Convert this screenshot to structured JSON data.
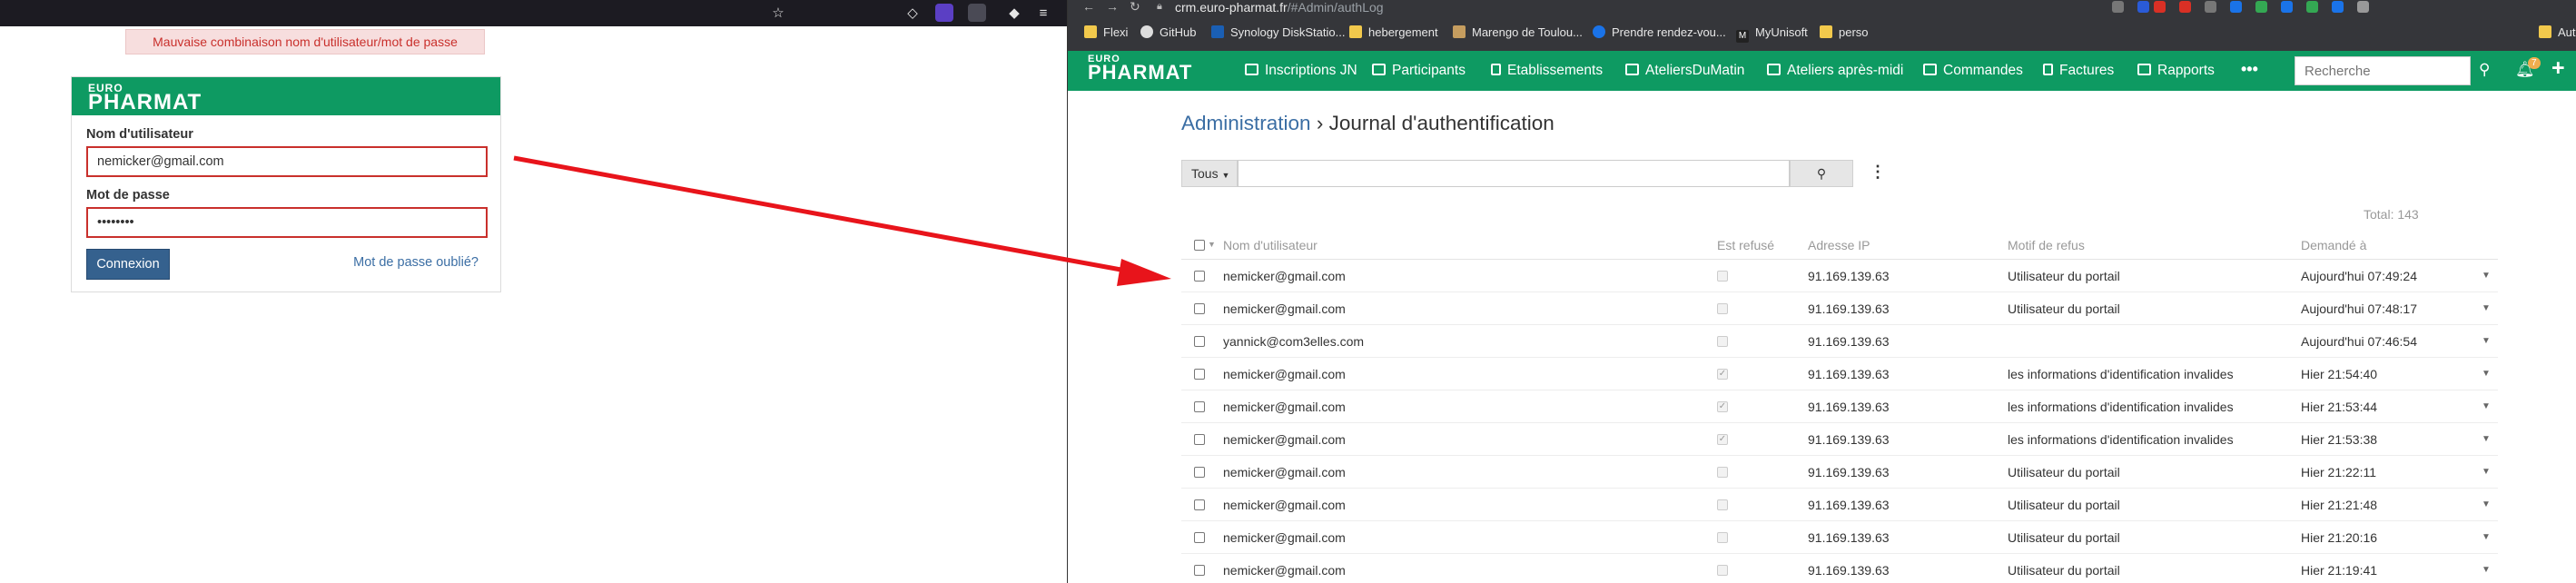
{
  "left": {
    "error_message": "Mauvaise combinaison nom d'utilisateur/mot de passe",
    "logo_small": "EURO",
    "logo_big": "PHARMAT",
    "username_label": "Nom d'utilisateur",
    "username_value": "nemicker@gmail.com",
    "password_label": "Mot de passe",
    "password_value": "••••••••",
    "login_button": "Connexion",
    "forgot_link": "Mot de passe oublié?"
  },
  "browser": {
    "url_host": "crm.euro-pharmat.fr",
    "url_path": "/#Admin/authLog",
    "bookmarks": [
      "Flexi",
      "GitHub",
      "Synology DiskStatio...",
      "hebergement",
      "Marengo de Toulou...",
      "Prendre rendez-vou...",
      "MyUnisoft",
      "perso",
      "Autr"
    ]
  },
  "app": {
    "logo_small": "EURO",
    "logo_big": "PHARMAT",
    "nav": [
      "Inscriptions JN",
      "Participants",
      "Etablissements",
      "AteliersDuMatin",
      "Ateliers après-midi",
      "Commandes",
      "Factures",
      "Rapports"
    ],
    "more": "•••",
    "search_placeholder": "Recherche",
    "notif_count": "7",
    "breadcrumb_root": "Administration",
    "breadcrumb_sep": "›",
    "breadcrumb_page": "Journal d'authentification",
    "filter_label": "Tous",
    "total": "Total: 143",
    "columns": [
      "Nom d'utilisateur",
      "Est refusé",
      "Adresse IP",
      "Motif de refus",
      "Demandé à"
    ],
    "rows": [
      {
        "user": "nemicker@gmail.com",
        "refused": false,
        "ip": "91.169.139.63",
        "reason": "Utilisateur du portail",
        "date": "Aujourd'hui 07:49:24"
      },
      {
        "user": "nemicker@gmail.com",
        "refused": false,
        "ip": "91.169.139.63",
        "reason": "Utilisateur du portail",
        "date": "Aujourd'hui 07:48:17"
      },
      {
        "user": "yannick@com3elles.com",
        "refused": false,
        "ip": "91.169.139.63",
        "reason": "",
        "date": "Aujourd'hui 07:46:54"
      },
      {
        "user": "nemicker@gmail.com",
        "refused": true,
        "ip": "91.169.139.63",
        "reason": "les informations d'identification invalides",
        "date": "Hier 21:54:40"
      },
      {
        "user": "nemicker@gmail.com",
        "refused": true,
        "ip": "91.169.139.63",
        "reason": "les informations d'identification invalides",
        "date": "Hier 21:53:44"
      },
      {
        "user": "nemicker@gmail.com",
        "refused": true,
        "ip": "91.169.139.63",
        "reason": "les informations d'identification invalides",
        "date": "Hier 21:53:38"
      },
      {
        "user": "nemicker@gmail.com",
        "refused": false,
        "ip": "91.169.139.63",
        "reason": "Utilisateur du portail",
        "date": "Hier 21:22:11"
      },
      {
        "user": "nemicker@gmail.com",
        "refused": false,
        "ip": "91.169.139.63",
        "reason": "Utilisateur du portail",
        "date": "Hier 21:21:48"
      },
      {
        "user": "nemicker@gmail.com",
        "refused": false,
        "ip": "91.169.139.63",
        "reason": "Utilisateur du portail",
        "date": "Hier 21:20:16"
      },
      {
        "user": "nemicker@gmail.com",
        "refused": false,
        "ip": "91.169.139.63",
        "reason": "Utilisateur du portail",
        "date": "Hier 21:19:41"
      }
    ]
  },
  "colors": {
    "brand_green": "#0e9a62",
    "error_red": "#c9302c",
    "link_blue": "#3b6ea4",
    "arrow_red": "#e8141b"
  }
}
